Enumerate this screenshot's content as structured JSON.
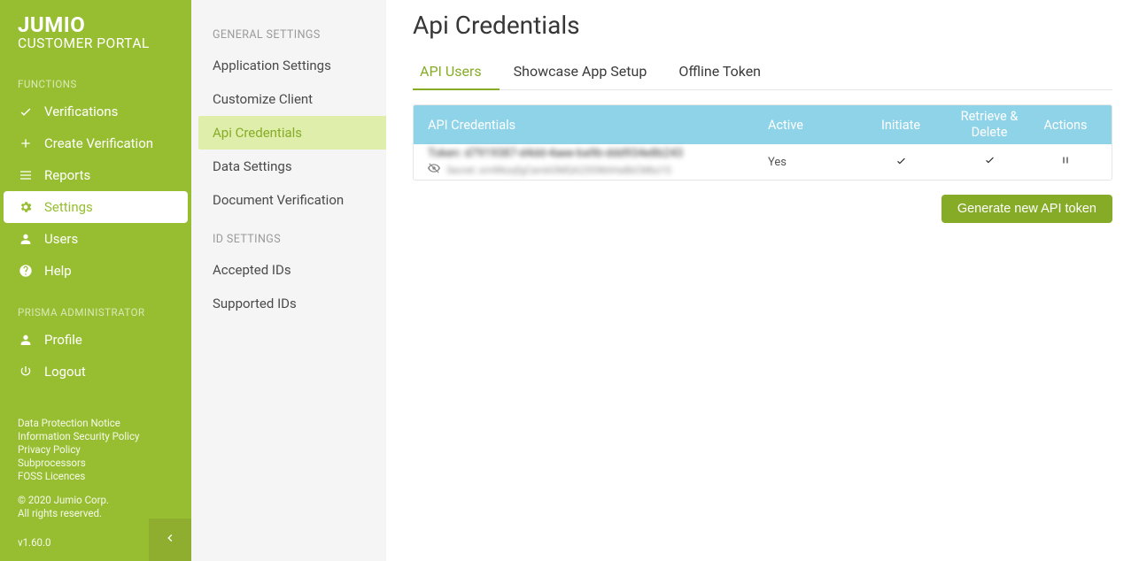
{
  "brand": {
    "title": "JUMIO",
    "subtitle": "CUSTOMER PORTAL"
  },
  "sidebar": {
    "sections": {
      "functions_label": "FUNCTIONS",
      "admin_label": "PRISMA ADMINISTRATOR"
    },
    "items": {
      "verifications": "Verifications",
      "create_verification": "Create Verification",
      "reports": "Reports",
      "settings": "Settings",
      "users": "Users",
      "help": "Help",
      "profile": "Profile",
      "logout": "Logout"
    },
    "footer_links": {
      "dpn": "Data Protection Notice",
      "isp": "Information Security Policy",
      "pp": "Privacy Policy",
      "subp": "Subprocessors",
      "foss": "FOSS Licences"
    },
    "legal1": "© 2020 Jumio Corp.",
    "legal2": "All rights reserved.",
    "version": "v1.60.0"
  },
  "subnav": {
    "general_label": "GENERAL SETTINGS",
    "id_label": "ID SETTINGS",
    "items": {
      "app_settings": "Application Settings",
      "customize_client": "Customize Client",
      "api_credentials": "Api Credentials",
      "data_settings": "Data Settings",
      "doc_verification": "Document Verification",
      "accepted_ids": "Accepted IDs",
      "supported_ids": "Supported IDs"
    }
  },
  "page": {
    "title": "Api Credentials"
  },
  "tabs": {
    "api_users": "API Users",
    "showcase": "Showcase App Setup",
    "offline": "Offline Token"
  },
  "table": {
    "headers": {
      "credentials": "API Credentials",
      "active": "Active",
      "initiate": "Initiate",
      "retrieve": "Retrieve & Delete",
      "actions": "Actions"
    },
    "row": {
      "token_line": "Token: d7919387-d4dd-4aee-ba9b-ddd934e8b243",
      "secret_line": "Secret: smWkzqfgCambOMQA23S9khHa8bCMbz1S",
      "active": "Yes"
    }
  },
  "buttons": {
    "generate": "Generate new API token"
  }
}
